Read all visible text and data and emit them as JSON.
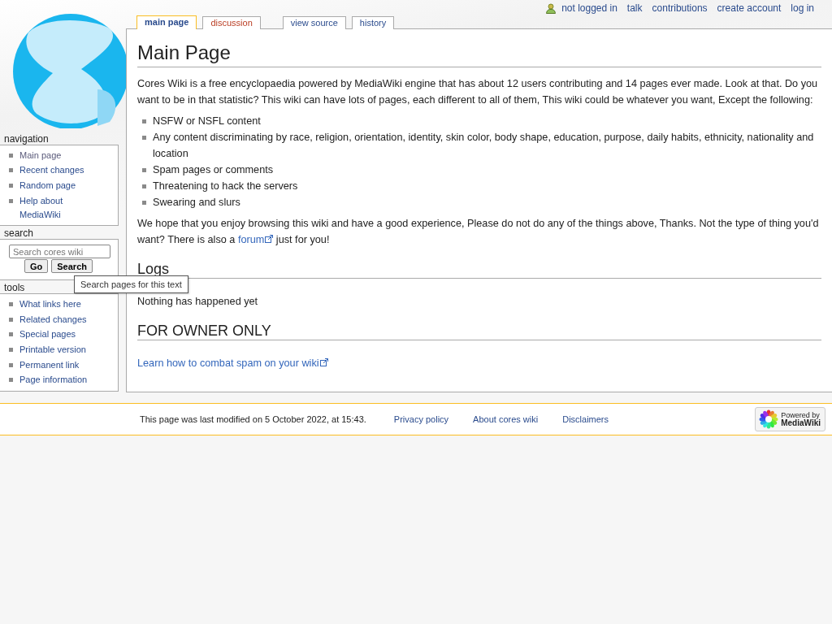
{
  "personal_links": [
    {
      "label": "not logged in",
      "kind": "user"
    },
    {
      "label": "talk",
      "kind": "link"
    },
    {
      "label": "contributions",
      "kind": "link"
    },
    {
      "label": "create account",
      "kind": "link"
    },
    {
      "label": "log in",
      "kind": "link"
    }
  ],
  "tabs": [
    {
      "label": "main page",
      "selected": true,
      "kind": "link"
    },
    {
      "label": "discussion",
      "selected": false,
      "kind": "redlink"
    },
    {
      "label": "view source",
      "selected": false,
      "kind": "link"
    },
    {
      "label": "history",
      "selected": false,
      "kind": "link"
    }
  ],
  "navigation": {
    "title": "navigation",
    "items": [
      {
        "label": "Main page",
        "visited": true
      },
      {
        "label": "Recent changes",
        "visited": false
      },
      {
        "label": "Random page",
        "visited": false
      },
      {
        "label": "Help about MediaWiki",
        "visited": false
      }
    ]
  },
  "search": {
    "title": "search",
    "placeholder": "Search cores wiki",
    "buttons": [
      "Go",
      "Search"
    ],
    "tooltip": "Search pages for this text"
  },
  "tools": {
    "title": "tools",
    "items": [
      {
        "label": "What links here",
        "visited": false
      },
      {
        "label": "Related changes",
        "visited": false
      },
      {
        "label": "Special pages",
        "visited": false
      },
      {
        "label": "Printable version",
        "visited": false
      },
      {
        "label": "Permanent link",
        "visited": false
      },
      {
        "label": "Page information",
        "visited": false
      }
    ]
  },
  "content": {
    "title": "Main Page",
    "intro": "Cores Wiki is a free encyclopaedia powered by MediaWiki engine that has about 12 users contributing and 14 pages ever made. Look at that. Do you want to be in that statistic? This wiki can have lots of pages, each different to all of them, This wiki could be whatever you want, Except the following:",
    "rules": [
      "NSFW or NSFL content",
      "Any content discriminating by race, religion, orientation, identity, skin color, body shape, education, purpose, daily habits, ethnicity, nationality and location",
      "Spam pages or comments",
      "Threatening to hack the servers",
      "Swearing and slurs"
    ],
    "closing": {
      "before": "We hope that you enjoy browsing this wiki and have a good experience, Please do not do any of the things above, Thanks. Not the type of thing you'd want? There is also a",
      "link": "forum",
      "after": "just for you!"
    },
    "sections": [
      {
        "heading": "Logs",
        "kind": "text",
        "text": "Nothing has happened yet"
      },
      {
        "heading": "FOR OWNER ONLY",
        "kind": "external-link",
        "text": "Learn how to combat spam on your wiki"
      }
    ]
  },
  "footer": {
    "modified": "This page was last modified on 5 October 2022, at 15:43.",
    "links": [
      "Privacy policy",
      "About cores wiki",
      "Disclaimers"
    ],
    "badge": [
      "Powered by",
      "MediaWiki"
    ]
  }
}
